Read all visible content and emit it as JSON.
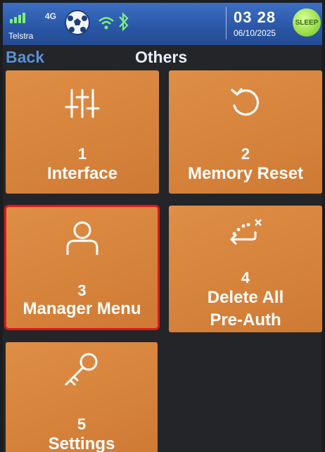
{
  "status_bar": {
    "network": "4G",
    "carrier": "Telstra",
    "time": "03 28",
    "date": "06/10/2025",
    "sleep_label": "SLEEP"
  },
  "header": {
    "back_label": "Back",
    "title": "Others"
  },
  "tiles": [
    {
      "number": "1",
      "label": "Interface",
      "icon": "sliders-icon",
      "selected": false
    },
    {
      "number": "2",
      "label": "Memory Reset",
      "icon": "reset-icon",
      "selected": false
    },
    {
      "number": "3",
      "label": "Manager Menu",
      "icon": "user-icon",
      "selected": true
    },
    {
      "number": "4",
      "label_lines": [
        "Delete All",
        "Pre-Auth"
      ],
      "icon": "delete-return-icon",
      "selected": false
    },
    {
      "number": "5",
      "label": "Settings",
      "icon": "key-icon",
      "selected": false
    }
  ],
  "colors": {
    "tile": "#d7843c",
    "status_bar": "#2a56a6",
    "selection": "#e01818",
    "back": "#5b8fd6"
  }
}
